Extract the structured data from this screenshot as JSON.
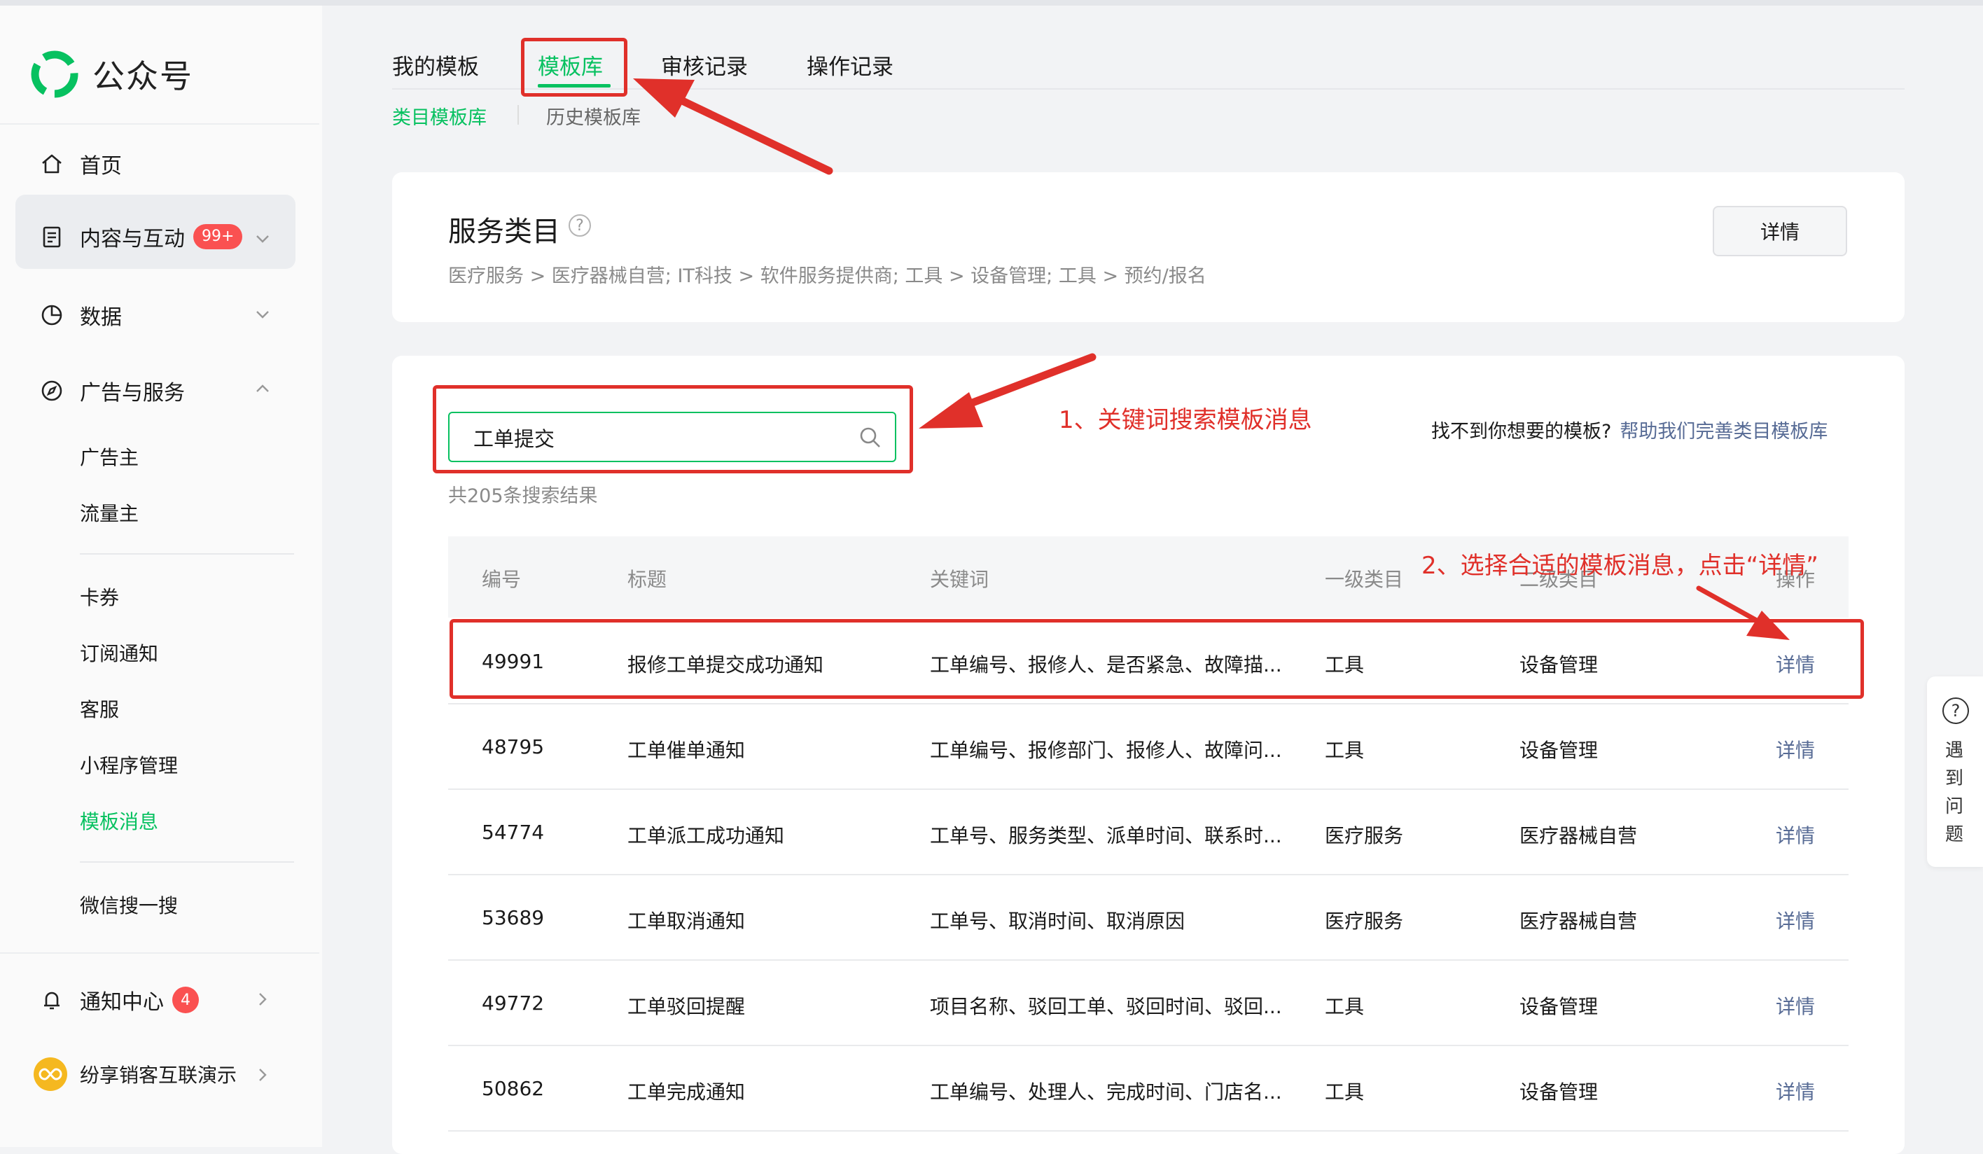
{
  "app": {
    "title": "公众号"
  },
  "sidebar": {
    "home": "首页",
    "content": {
      "label": "内容与互动",
      "badge": "99+"
    },
    "data": "数据",
    "ads": {
      "label": "广告与服务",
      "items": [
        "广告主",
        "流量主",
        "卡券",
        "订阅通知",
        "客服",
        "小程序管理",
        "模板消息",
        "微信搜一搜"
      ]
    },
    "notify": {
      "label": "通知中心",
      "badge": "4"
    },
    "account": "纷享销客互联演示"
  },
  "tabs": [
    "我的模板",
    "模板库",
    "审核记录",
    "操作记录"
  ],
  "active_tab": "模板库",
  "subtabs": [
    "类目模板库",
    "历史模板库"
  ],
  "service": {
    "title": "服务类目",
    "help": "?",
    "path": "医疗服务 > 医疗器械自营; IT科技 > 软件服务提供商; 工具 > 设备管理; 工具 > 预约/报名",
    "detail_button": "详情"
  },
  "search": {
    "value": "工单提交",
    "result_count": "共205条搜索结果"
  },
  "missing": {
    "question": "找不到你想要的模板?",
    "link": "帮助我们完善类目模板库"
  },
  "table": {
    "headers": [
      "编号",
      "标题",
      "关键词",
      "一级类目",
      "二级类目",
      "操作"
    ],
    "rows": [
      {
        "id": "49991",
        "title": "报修工单提交成功通知",
        "keywords": "工单编号、报修人、是否紧急、故障描...",
        "cat1": "工具",
        "cat2": "设备管理",
        "op": "详情"
      },
      {
        "id": "48795",
        "title": "工单催单通知",
        "keywords": "工单编号、报修部门、报修人、故障问...",
        "cat1": "工具",
        "cat2": "设备管理",
        "op": "详情"
      },
      {
        "id": "54774",
        "title": "工单派工成功通知",
        "keywords": "工单号、服务类型、派单时间、联系时...",
        "cat1": "医疗服务",
        "cat2": "医疗器械自营",
        "op": "详情"
      },
      {
        "id": "53689",
        "title": "工单取消通知",
        "keywords": "工单号、取消时间、取消原因",
        "cat1": "医疗服务",
        "cat2": "医疗器械自营",
        "op": "详情"
      },
      {
        "id": "49772",
        "title": "工单驳回提醒",
        "keywords": "项目名称、驳回工单、驳回时间、驳回...",
        "cat1": "工具",
        "cat2": "设备管理",
        "op": "详情"
      },
      {
        "id": "50862",
        "title": "工单完成通知",
        "keywords": "工单编号、处理人、完成时间、门店名...",
        "cat1": "工具",
        "cat2": "设备管理",
        "op": "详情"
      }
    ]
  },
  "annotations": {
    "step1": "1、关键词搜索模板消息",
    "step2": "2、选择合适的模板消息，点击“详情”"
  },
  "float_help": "遇到问题",
  "colors": {
    "brand_green": "#07c160",
    "link_blue": "#576b95",
    "annotation_red": "#e0302a",
    "badge_red": "#fa5151"
  },
  "icons": [
    "home-icon",
    "document-icon",
    "chart-pie-icon",
    "compass-icon",
    "bell-icon",
    "search-icon",
    "help-icon",
    "chevron-down-icon",
    "chevron-up-icon",
    "chevron-right-icon"
  ]
}
